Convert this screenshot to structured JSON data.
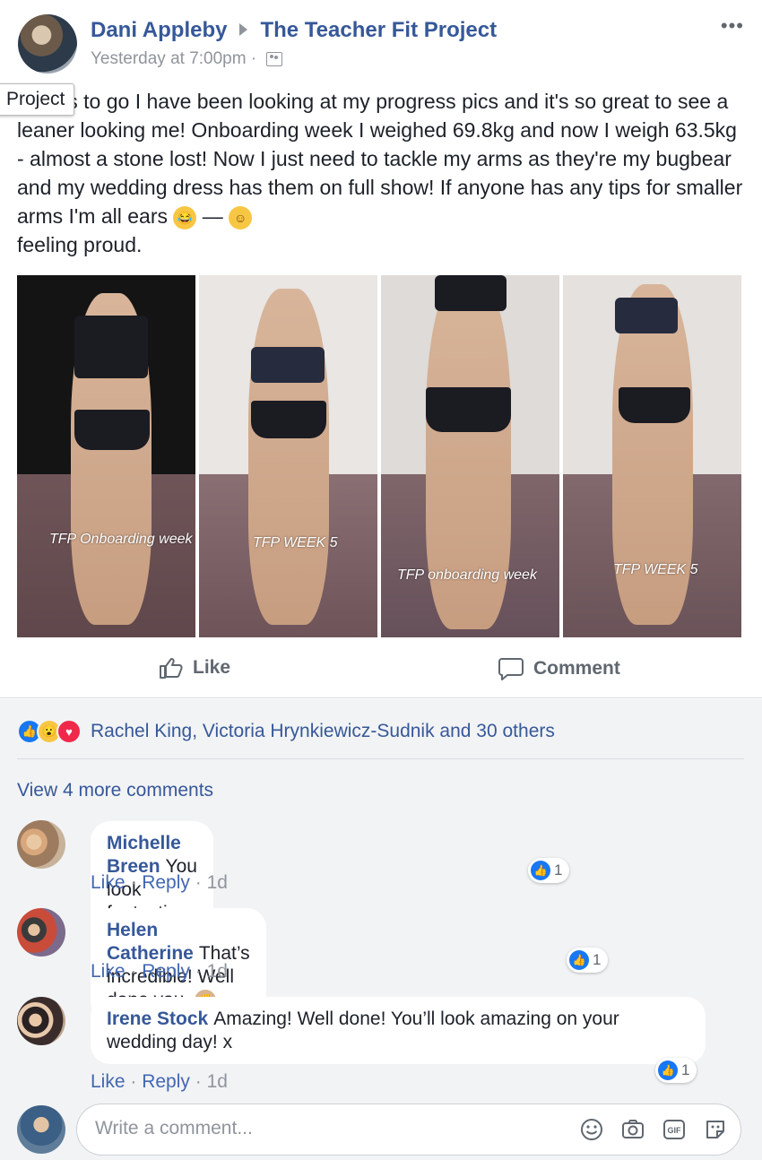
{
  "post": {
    "author": "Dani Appleby",
    "group": "The Teacher Fit Project",
    "time": "Yesterday at 7:00pm",
    "separator": "·",
    "more": "•••",
    "tooltip": "Project",
    "text": "7 days to go I have been looking at my progress pics and it's so great to see a leaner looking me! Onboarding week I weighed 69.8kg and now I weigh 63.5kg - almost a stone lost! Now I just need to tackle my arms as they're my bugbear and my wedding dress has them on full show! If anyone has any tips for smaller arms I'm all ears",
    "dash": "—",
    "feeling": "feeling proud.",
    "photo_captions": [
      "TFP Onboarding week",
      "TFP WEEK 5",
      "TFP onboarding week",
      "TFP WEEK 5"
    ],
    "actions": {
      "like": "Like",
      "comment": "Comment"
    }
  },
  "reactions": {
    "summary": "Rachel King, Victoria Hrynkiewicz-Sudnik and 30 others",
    "types": [
      "like",
      "wow",
      "love"
    ]
  },
  "view_more": "View 4 more comments",
  "comments": [
    {
      "name": "Michelle Breen",
      "text": "You look fantastic. - we’ll done xx",
      "like": "Like",
      "reply": "Reply",
      "time": "1d",
      "count": "1"
    },
    {
      "name": "Helen Catherine",
      "text": "That’s incredible! Well done you.",
      "like": "Like",
      "reply": "Reply",
      "time": "1d",
      "count": "1"
    },
    {
      "name": "Irene Stock",
      "text": "Amazing! Well done! You’ll look amazing on your wedding day! x",
      "like": "Like",
      "reply": "Reply",
      "time": "1d",
      "count": "1"
    }
  ],
  "write": {
    "placeholder": "Write a comment..."
  },
  "colors": {
    "link": "#365899",
    "meta": "#90949c",
    "bg": "#f2f3f5",
    "like": "#1877f2",
    "love": "#f0284a"
  },
  "icons": [
    "emoji-icon",
    "camera-icon",
    "gif-icon",
    "sticker-icon"
  ]
}
